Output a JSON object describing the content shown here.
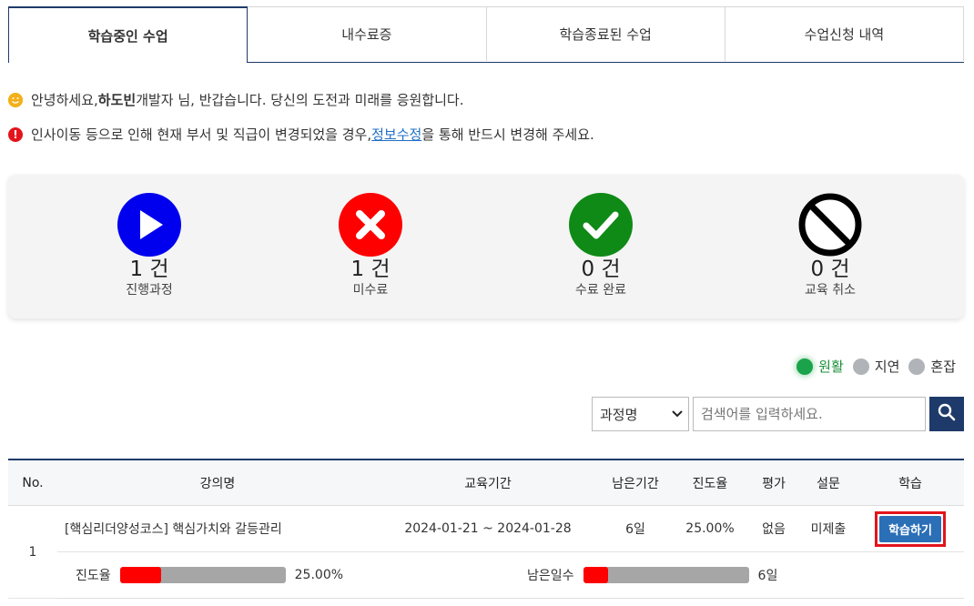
{
  "tabs": [
    "학습중인 수업",
    "내수료증",
    "학습종료된 수업",
    "수업신청 내역"
  ],
  "notices": {
    "greeting_prefix": "안녕하세요, ",
    "greeting_name": "하도빈",
    "greeting_suffix": " 개발자 님, 반갑습니다. 당신의 도전과 미래를 응원합니다.",
    "alert_prefix": "인사이동 등으로 인해 현재 부서 및 직급이 변경되었을 경우, ",
    "alert_link": "정보수정",
    "alert_suffix": "을 통해 반드시 변경해 주세요."
  },
  "summary": [
    {
      "count": "1 건",
      "label": "진행과정",
      "color": "#0000ee",
      "icon": "play-icon"
    },
    {
      "count": "1 건",
      "label": "미수료",
      "color": "#ff0000",
      "icon": "x-icon"
    },
    {
      "count": "0 건",
      "label": "수료 완료",
      "color": "#0f8a16",
      "icon": "check-icon"
    },
    {
      "count": "0 건",
      "label": "교육 취소",
      "color": "#000000",
      "icon": "prohibited-icon"
    }
  ],
  "legend": {
    "smooth": "원활",
    "delay": "지연",
    "busy": "혼잡"
  },
  "search": {
    "select_value": "과정명",
    "placeholder": "검색어를 입력하세요."
  },
  "table": {
    "headers": [
      "No.",
      "강의명",
      "교육기간",
      "남은기간",
      "진도율",
      "평가",
      "설문",
      "학습"
    ],
    "rows": [
      {
        "no": "1",
        "title": "[핵심리더양성코스] 핵심가치와 갈등관리",
        "period": "2024-01-21 ~ 2024-01-28",
        "remaining": "6일",
        "progress": "25.00%",
        "evaluation": "없음",
        "survey": "미제출",
        "action": "학습하기",
        "progress_label": "진도율",
        "progress_fraction": 0.25,
        "remaining_label": "남은일수",
        "remaining_fraction": 0.15,
        "remaining_value": "6일"
      }
    ]
  }
}
